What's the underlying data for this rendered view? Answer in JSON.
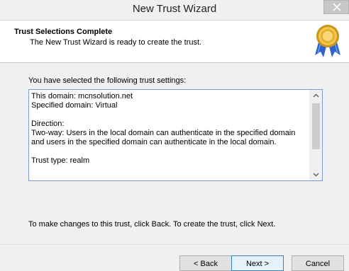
{
  "window": {
    "title": "New Trust Wizard"
  },
  "header": {
    "title": "Trust Selections Complete",
    "subtitle": "The New Trust Wizard is ready to create the trust.",
    "icon": "award-seal-icon"
  },
  "main": {
    "intro": "You have selected the following trust settings:",
    "settings_lines": [
      "This domain: mcnsolution.net",
      "Specified domain: Virtual",
      "",
      "Direction:",
      "Two-way: Users in the local domain can authenticate in the specified domain and users in the specified domain can authenticate in the local domain.",
      "",
      "Trust type: realm"
    ],
    "footer_note": "To make changes to this trust, click Back. To create the trust, click Next."
  },
  "buttons": {
    "back": "< Back",
    "next": "Next >",
    "cancel": "Cancel"
  },
  "colors": {
    "accent": "#3c7fb1",
    "box_border": "#7a9cd3"
  }
}
